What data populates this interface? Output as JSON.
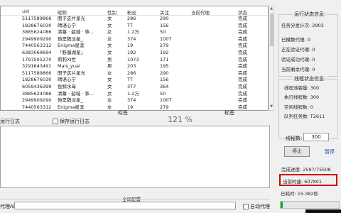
{
  "table": {
    "columns": [
      "uid",
      "昵称",
      "性别",
      "粉丝",
      "关注",
      "当前代理",
      "状态"
    ],
    "rows": [
      [
        "5117589866",
        "图子这片星光",
        "女",
        "286",
        "290",
        "",
        "完成"
      ],
      [
        "1828676030",
        "晴语心宁",
        "女",
        "TT",
        "156",
        "",
        "完成"
      ],
      [
        "3885624086",
        "清幕 · 韶城 · 筝...",
        "女",
        "1.2万",
        "50",
        "",
        "完成"
      ],
      [
        "2949909290",
        "他是魏淡星_",
        "女",
        "374",
        "100T",
        "",
        "完成"
      ],
      [
        "7440563312",
        "Enigma星涯",
        "女",
        "19",
        "279",
        "",
        "完成"
      ],
      [
        "6383069694",
        "「断僵湖星」",
        "女",
        "192",
        "192",
        "",
        "完成"
      ],
      [
        "1797505270",
        "莉莉XI世",
        "男",
        "1073",
        "171",
        "",
        "完成"
      ],
      [
        "3291643491",
        "Mais_yuai",
        "男",
        "203",
        "195",
        "",
        "完成"
      ],
      [
        "5117589866",
        "图子这片星光",
        "女",
        "286",
        "290",
        "",
        "完成"
      ],
      [
        "1828676030",
        "晴语心宁",
        "女",
        "TT",
        "156",
        "",
        "完成"
      ],
      [
        "6059436399",
        "鱼鲸水母",
        "女",
        "3T7",
        "364",
        "",
        "完成"
      ],
      [
        "3885624086",
        "清幕 · 韶城 · 筝...",
        "女",
        "1.2万",
        "50",
        "",
        "完成"
      ],
      [
        "2949909290",
        "他是魏淡星_",
        "女",
        "374",
        "100T",
        "",
        "完成"
      ],
      [
        "7440563312",
        "Enigma星涯",
        "女",
        "19",
        "279",
        "",
        "完成"
      ]
    ],
    "percent_overlay": "121 %"
  },
  "log": {
    "run_log_label": "运行日志",
    "save_log_label": "保存运行日志",
    "col_label_1": "标签",
    "col_label_2": "标签"
  },
  "config": {
    "title": "全局配置",
    "api_label": "代理API",
    "auto_proxy_label": "自动代理"
  },
  "status_panel": {
    "title": "运行状态信息:",
    "total_tasks": "任务分发计次: 2903",
    "fetched": "已模数代理: 0",
    "verifying": "正在验证代理: 0",
    "verified": "验证成功代理: 0",
    "remaining": "当前剩余代理: 0"
  },
  "thread_panel": {
    "title": "线程状态信息:",
    "capacity": "线程池容量: 300",
    "executing": "执行线程数: 300",
    "idle": "空闲线程数: 0",
    "queue": "队列任务数: T2611"
  },
  "controls": {
    "thread_count_label": "线程数:",
    "thread_count_value": "300",
    "stop_label": "停止",
    "pause_label": "暂停",
    "progress_text": "完成进度: 2597/75508",
    "current_time": "当前时速: 607801",
    "elapsed": "已耗时: 15.382秒",
    "progress_fraction": 0.034
  }
}
